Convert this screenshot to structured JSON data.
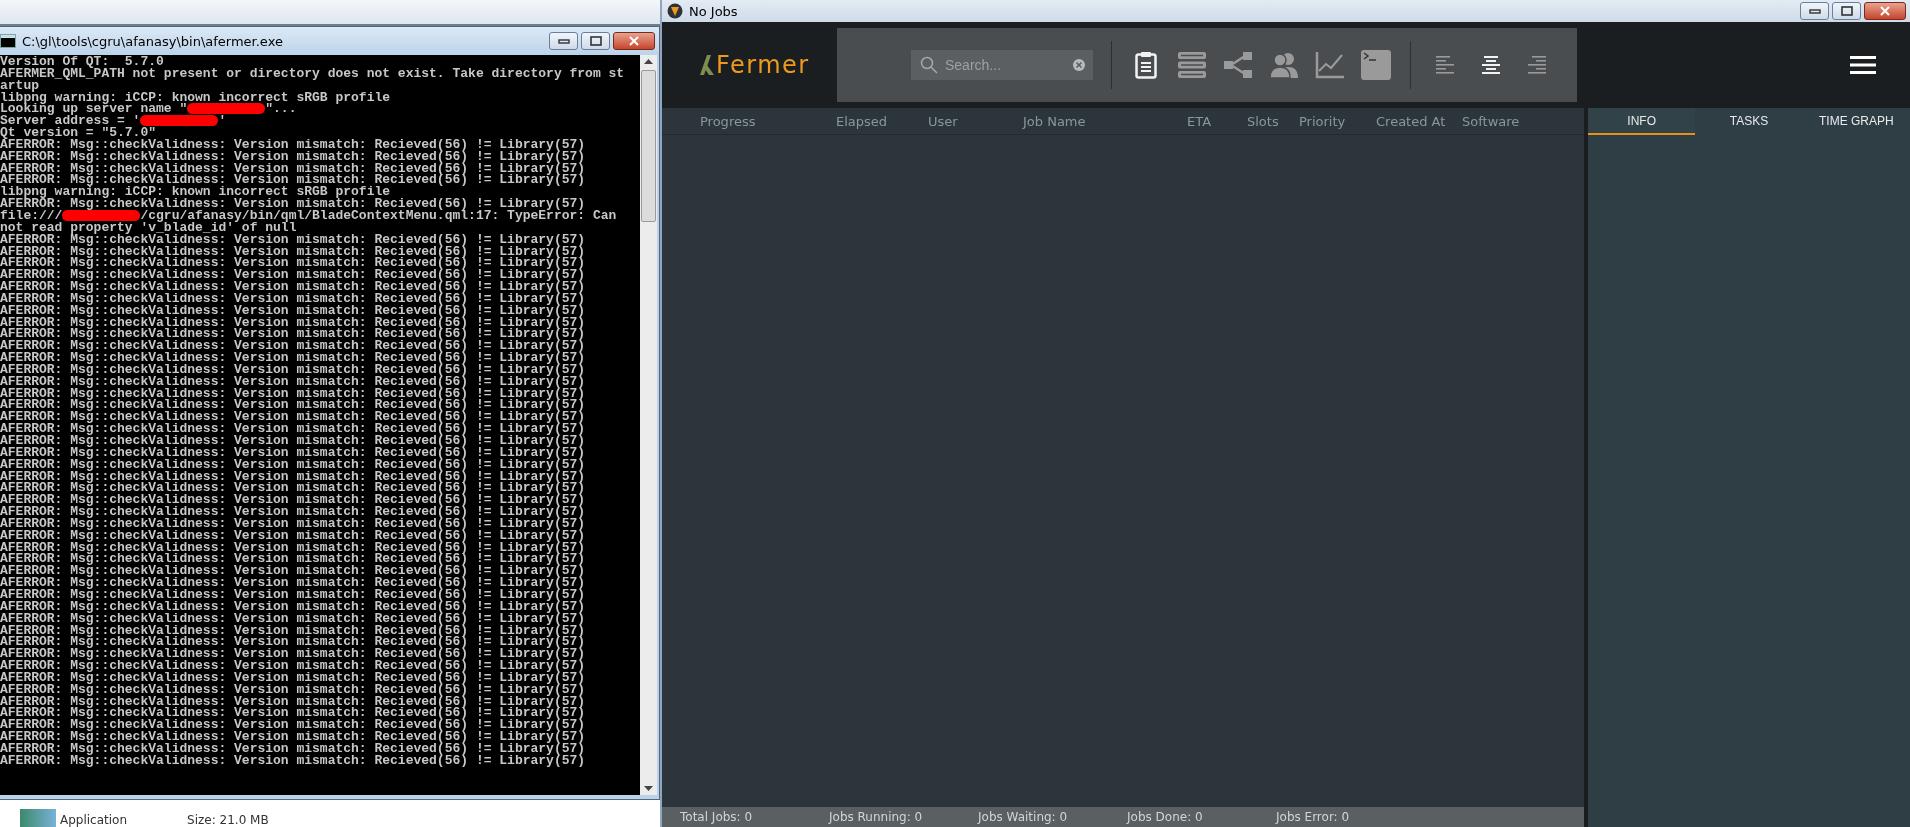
{
  "explorer": {
    "file_type": "Application",
    "file_size": "Size: 21.0 MB"
  },
  "console": {
    "title": "C:\\gl\\tools\\cgru\\afanasy\\bin\\afermer.exe",
    "lines": [
      {
        "kind": "text",
        "text": "Version Of QT:  5.7.0"
      },
      {
        "kind": "text",
        "text": "AFERMER_QML_PATH not present or directory does not exist. Take directory from st"
      },
      {
        "kind": "text",
        "text": "artup"
      },
      {
        "kind": "text",
        "text": "libpng warning: iCCP: known incorrect sRGB profile"
      },
      {
        "kind": "redacted",
        "before": "Looking up server name \"",
        "after": "\"..."
      },
      {
        "kind": "redacted",
        "before": "Server address = '",
        "after": "'"
      },
      {
        "kind": "text",
        "text": "Qt version = \"5.7.0\""
      },
      {
        "kind": "text",
        "text": "AFERROR: Msg::checkValidness: Version mismatch: Recieved(56) != Library(57)"
      },
      {
        "kind": "text",
        "text": "AFERROR: Msg::checkValidness: Version mismatch: Recieved(56) != Library(57)"
      },
      {
        "kind": "text",
        "text": "AFERROR: Msg::checkValidness: Version mismatch: Recieved(56) != Library(57)"
      },
      {
        "kind": "text",
        "text": "AFERROR: Msg::checkValidness: Version mismatch: Recieved(56) != Library(57)"
      },
      {
        "kind": "text",
        "text": "libpng warning: iCCP: known incorrect sRGB profile"
      },
      {
        "kind": "text",
        "text": "AFERROR: Msg::checkValidness: Version mismatch: Recieved(56) != Library(57)"
      },
      {
        "kind": "redacted",
        "before": "file:///",
        "after": "/cgru/afanasy/bin/qml/BladeContextMenu.qml:17: TypeError: Can"
      },
      {
        "kind": "text",
        "text": "not read property 'v_blade_id' of null"
      },
      {
        "kind": "text",
        "text": "AFERROR: Msg::checkValidness: Version mismatch: Recieved(56) != Library(57)"
      },
      {
        "kind": "text",
        "text": "AFERROR: Msg::checkValidness: Version mismatch: Recieved(56) != Library(57)"
      },
      {
        "kind": "text",
        "text": "AFERROR: Msg::checkValidness: Version mismatch: Recieved(56) != Library(57)"
      },
      {
        "kind": "text",
        "text": "AFERROR: Msg::checkValidness: Version mismatch: Recieved(56) != Library(57)"
      },
      {
        "kind": "text",
        "text": "AFERROR: Msg::checkValidness: Version mismatch: Recieved(56) != Library(57)"
      },
      {
        "kind": "text",
        "text": "AFERROR: Msg::checkValidness: Version mismatch: Recieved(56) != Library(57)"
      },
      {
        "kind": "text",
        "text": "AFERROR: Msg::checkValidness: Version mismatch: Recieved(56) != Library(57)"
      },
      {
        "kind": "text",
        "text": "AFERROR: Msg::checkValidness: Version mismatch: Recieved(56) != Library(57)"
      },
      {
        "kind": "text",
        "text": "AFERROR: Msg::checkValidness: Version mismatch: Recieved(56) != Library(57)"
      },
      {
        "kind": "text",
        "text": "AFERROR: Msg::checkValidness: Version mismatch: Recieved(56) != Library(57)"
      },
      {
        "kind": "text",
        "text": "AFERROR: Msg::checkValidness: Version mismatch: Recieved(56) != Library(57)"
      },
      {
        "kind": "text",
        "text": "AFERROR: Msg::checkValidness: Version mismatch: Recieved(56) != Library(57)"
      },
      {
        "kind": "text",
        "text": "AFERROR: Msg::checkValidness: Version mismatch: Recieved(56) != Library(57)"
      },
      {
        "kind": "text",
        "text": "AFERROR: Msg::checkValidness: Version mismatch: Recieved(56) != Library(57)"
      },
      {
        "kind": "text",
        "text": "AFERROR: Msg::checkValidness: Version mismatch: Recieved(56) != Library(57)"
      },
      {
        "kind": "text",
        "text": "AFERROR: Msg::checkValidness: Version mismatch: Recieved(56) != Library(57)"
      },
      {
        "kind": "text",
        "text": "AFERROR: Msg::checkValidness: Version mismatch: Recieved(56) != Library(57)"
      },
      {
        "kind": "text",
        "text": "AFERROR: Msg::checkValidness: Version mismatch: Recieved(56) != Library(57)"
      },
      {
        "kind": "text",
        "text": "AFERROR: Msg::checkValidness: Version mismatch: Recieved(56) != Library(57)"
      },
      {
        "kind": "text",
        "text": "AFERROR: Msg::checkValidness: Version mismatch: Recieved(56) != Library(57)"
      },
      {
        "kind": "text",
        "text": "AFERROR: Msg::checkValidness: Version mismatch: Recieved(56) != Library(57)"
      },
      {
        "kind": "text",
        "text": "AFERROR: Msg::checkValidness: Version mismatch: Recieved(56) != Library(57)"
      },
      {
        "kind": "text",
        "text": "AFERROR: Msg::checkValidness: Version mismatch: Recieved(56) != Library(57)"
      },
      {
        "kind": "text",
        "text": "AFERROR: Msg::checkValidness: Version mismatch: Recieved(56) != Library(57)"
      },
      {
        "kind": "text",
        "text": "AFERROR: Msg::checkValidness: Version mismatch: Recieved(56) != Library(57)"
      },
      {
        "kind": "text",
        "text": "AFERROR: Msg::checkValidness: Version mismatch: Recieved(56) != Library(57)"
      },
      {
        "kind": "text",
        "text": "AFERROR: Msg::checkValidness: Version mismatch: Recieved(56) != Library(57)"
      },
      {
        "kind": "text",
        "text": "AFERROR: Msg::checkValidness: Version mismatch: Recieved(56) != Library(57)"
      },
      {
        "kind": "text",
        "text": "AFERROR: Msg::checkValidness: Version mismatch: Recieved(56) != Library(57)"
      },
      {
        "kind": "text",
        "text": "AFERROR: Msg::checkValidness: Version mismatch: Recieved(56) != Library(57)"
      },
      {
        "kind": "text",
        "text": "AFERROR: Msg::checkValidness: Version mismatch: Recieved(56) != Library(57)"
      },
      {
        "kind": "text",
        "text": "AFERROR: Msg::checkValidness: Version mismatch: Recieved(56) != Library(57)"
      },
      {
        "kind": "text",
        "text": "AFERROR: Msg::checkValidness: Version mismatch: Recieved(56) != Library(57)"
      },
      {
        "kind": "text",
        "text": "AFERROR: Msg::checkValidness: Version mismatch: Recieved(56) != Library(57)"
      },
      {
        "kind": "text",
        "text": "AFERROR: Msg::checkValidness: Version mismatch: Recieved(56) != Library(57)"
      },
      {
        "kind": "text",
        "text": "AFERROR: Msg::checkValidness: Version mismatch: Recieved(56) != Library(57)"
      },
      {
        "kind": "text",
        "text": "AFERROR: Msg::checkValidness: Version mismatch: Recieved(56) != Library(57)"
      },
      {
        "kind": "text",
        "text": "AFERROR: Msg::checkValidness: Version mismatch: Recieved(56) != Library(57)"
      },
      {
        "kind": "text",
        "text": "AFERROR: Msg::checkValidness: Version mismatch: Recieved(56) != Library(57)"
      },
      {
        "kind": "text",
        "text": "AFERROR: Msg::checkValidness: Version mismatch: Recieved(56) != Library(57)"
      },
      {
        "kind": "text",
        "text": "AFERROR: Msg::checkValidness: Version mismatch: Recieved(56) != Library(57)"
      },
      {
        "kind": "text",
        "text": "AFERROR: Msg::checkValidness: Version mismatch: Recieved(56) != Library(57)"
      },
      {
        "kind": "text",
        "text": "AFERROR: Msg::checkValidness: Version mismatch: Recieved(56) != Library(57)"
      },
      {
        "kind": "text",
        "text": "AFERROR: Msg::checkValidness: Version mismatch: Recieved(56) != Library(57)"
      },
      {
        "kind": "text",
        "text": "AFERROR: Msg::checkValidness: Version mismatch: Recieved(56) != Library(57)"
      }
    ]
  },
  "app": {
    "title": "No Jobs",
    "logo": "Fermer",
    "search": {
      "placeholder": "Search..."
    },
    "views": [
      {
        "kind": "clipboard",
        "selected": true
      },
      {
        "kind": "servers",
        "selected": false
      },
      {
        "kind": "share",
        "selected": false
      },
      {
        "kind": "users",
        "selected": false
      },
      {
        "kind": "chart",
        "selected": false
      },
      {
        "kind": "terminal",
        "selected": false
      }
    ],
    "alignments": [
      {
        "kind": "left",
        "selected": false
      },
      {
        "kind": "center",
        "selected": true
      },
      {
        "kind": "right",
        "selected": false
      }
    ],
    "table": {
      "columns": [
        "Progress",
        "Elapsed",
        "User",
        "Job Name",
        "ETA",
        "Slots",
        "Priority",
        "Created At",
        "Software"
      ]
    },
    "tabs": [
      {
        "label": "INFO",
        "selected": true
      },
      {
        "label": "TASKS",
        "selected": false
      },
      {
        "label": "TIME GRAPH",
        "selected": false
      }
    ],
    "status_bar": [
      "Total Jobs: 0",
      "Jobs Running: 0",
      "Jobs Waiting: 0",
      "Jobs Done: 0",
      "Jobs Error: 0"
    ]
  }
}
